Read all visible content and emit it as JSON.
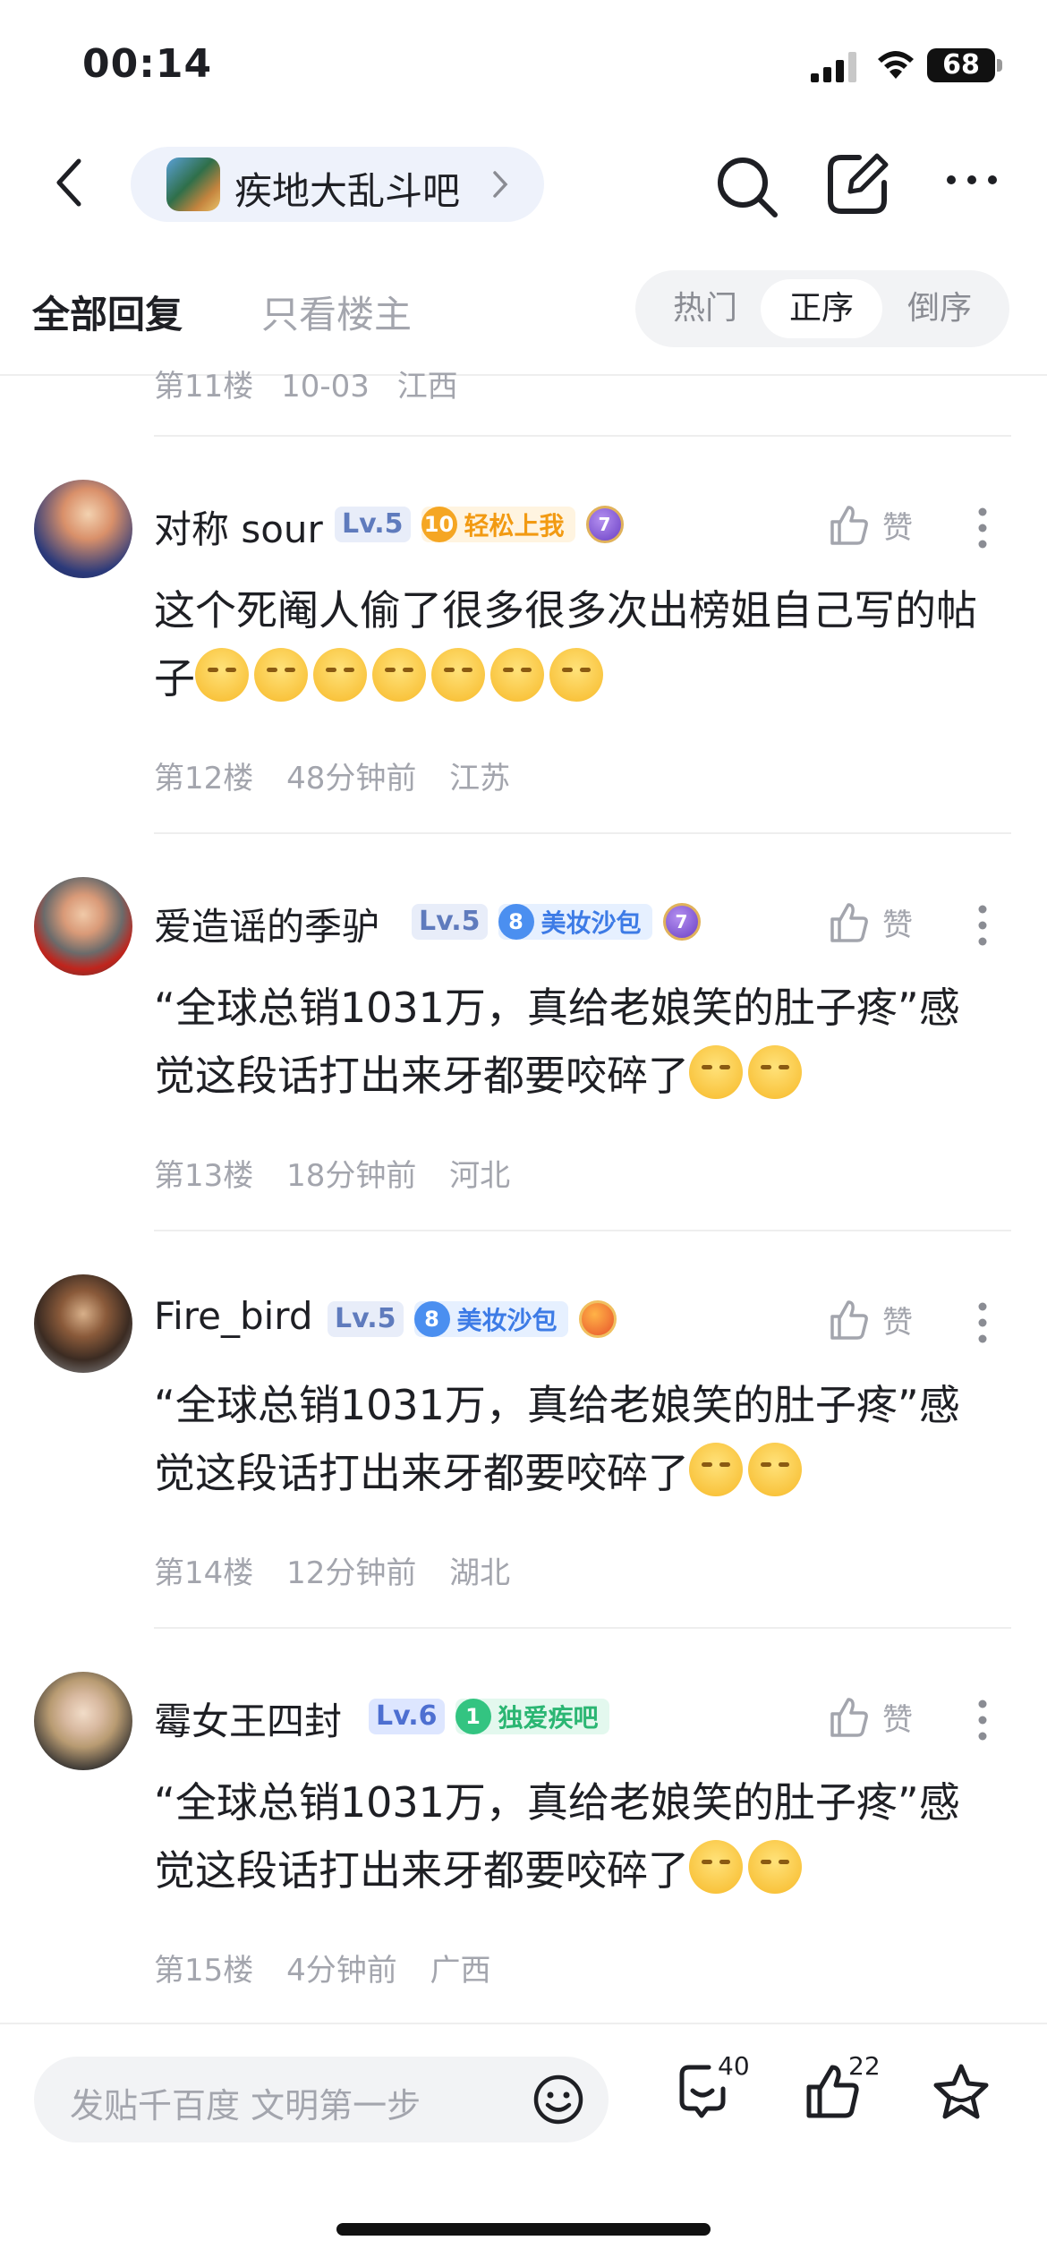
{
  "status_bar": {
    "time": "00:14",
    "battery": "68"
  },
  "nav": {
    "forum_name": "疾地大乱斗吧"
  },
  "tabs": {
    "all": "全部回复",
    "op_only": "只看楼主"
  },
  "sort": {
    "options": [
      "热门",
      "正序",
      "倒序"
    ],
    "selected": "正序"
  },
  "previous_floor": {
    "floor": "第11楼",
    "time": "10-03",
    "location": "江西"
  },
  "posts": [
    {
      "username": "对称 sour",
      "level": "Lv.5",
      "honor_level": "10",
      "honor_name": "轻松上我",
      "medal": "7",
      "like_label": "赞",
      "text": "这个死阉人偷了很多很多次出榜姐自己写的帖子",
      "emoji_count": 7,
      "floor": "第12楼",
      "time": "48分钟前",
      "location": "江苏"
    },
    {
      "username": "爱造谣的季驴",
      "level": "Lv.5",
      "honor_level": "8",
      "honor_name": "美妆沙包",
      "medal": "7",
      "like_label": "赞",
      "text": "“全球总销1031万，真给老娘笑的肚子疼”感觉这段话打出来牙都要咬碎了",
      "emoji_count": 2,
      "floor": "第13楼",
      "time": "18分钟前",
      "location": "河北"
    },
    {
      "username": "Fire_bird",
      "level": "Lv.5",
      "honor_level": "8",
      "honor_name": "美妆沙包",
      "medal": "",
      "like_label": "赞",
      "text": "“全球总销1031万，真给老娘笑的肚子疼”感觉这段话打出来牙都要咬碎了",
      "emoji_count": 2,
      "floor": "第14楼",
      "time": "12分钟前",
      "location": "湖北"
    },
    {
      "username": "霉女王四封",
      "level": "Lv.6",
      "honor_level": "1",
      "honor_name": "独爱疾吧",
      "medal": "",
      "like_label": "赞",
      "text": "“全球总销1031万，真给老娘笑的肚子疼”感觉这段话打出来牙都要咬碎了",
      "emoji_count": 2,
      "floor": "第15楼",
      "time": "4分钟前",
      "location": "广西"
    }
  ],
  "bottom_bar": {
    "placeholder": "发贴千百度 文明第一步",
    "comment_count": "40",
    "like_count": "22"
  },
  "icons": [
    "back-icon",
    "chevron-right-icon",
    "search-icon",
    "edit-icon",
    "more-icon",
    "thumbs-up-icon",
    "smiley-icon",
    "comment-icon",
    "star-icon"
  ]
}
